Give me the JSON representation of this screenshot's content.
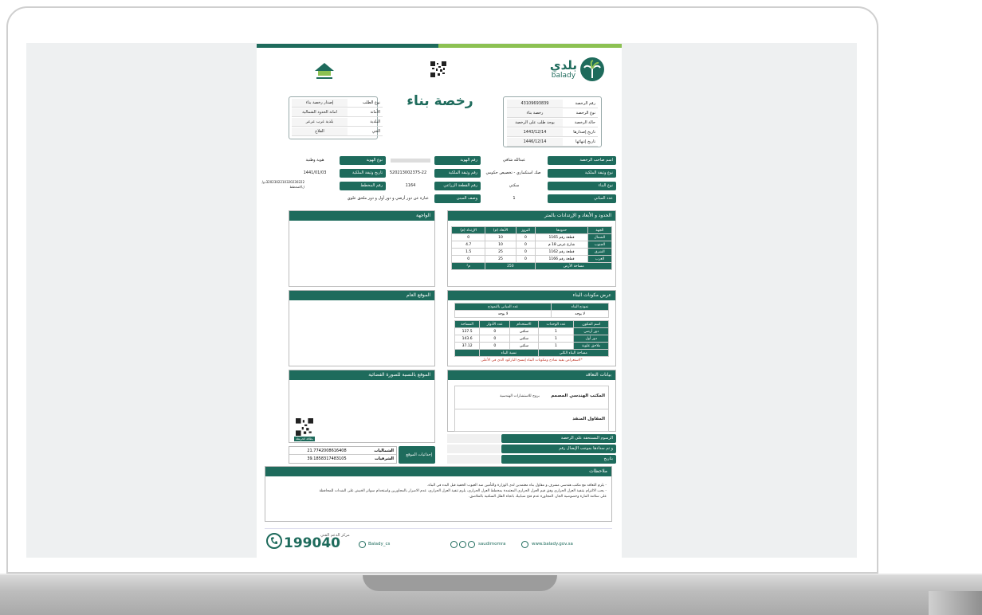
{
  "header": {
    "logo_ar": "بلدي",
    "logo_en": "balady",
    "title": "رخصة بناء"
  },
  "license_info": [
    {
      "label": "رقم الرخصة",
      "value": "43109693839"
    },
    {
      "label": "نوع الرخصة",
      "value": "رخصة بناء"
    },
    {
      "label": "حالة الرخصة",
      "value": "يوجد طلب على الرخصة"
    },
    {
      "label": "تاريخ إصدارها",
      "value": "1443/12/14"
    },
    {
      "label": "تاريخ إنتهائها",
      "value": "1446/12/14"
    }
  ],
  "request_info": [
    {
      "label": "نوع الطلب",
      "value": "إصدار رخصة بناء"
    },
    {
      "label": "الأمانة",
      "value": "امانة الحدود الشمالية"
    },
    {
      "label": "البلدية",
      "value": "بلدية غرب عرعر"
    },
    {
      "label": "الحي",
      "value": "الفلاح"
    }
  ],
  "owner": {
    "owner_label": "اسم صاحب الرخصة",
    "owner_value": "عبدالله شافي",
    "id_label": "رقم الهوية",
    "id_value": "",
    "id_type_label": "نوع الهوية",
    "id_type_value": "هوية وطنية",
    "deed_type_label": "نوع وثيقة الملكية",
    "deed_type_value": "صك استكماري - تخصيص حكومي",
    "deed_no_label": "رقم وثيقة الملكية",
    "deed_no_value": "520213002375-22",
    "deed_date_label": "تاريخ وثيقة الملكية",
    "deed_date_value": "1441/01/03",
    "build_type_label": "نوع البناء",
    "build_type_value": "سكني",
    "plot_label": "رقم القطعة الزراعي",
    "plot_value": "1164",
    "plan_label": "رقم المخطط",
    "plan_value": "3202302210320230222ذو/ل/المخطط",
    "count_label": "عدد المباني",
    "count_value": "1",
    "desc_label": "وصف المبنى",
    "desc_value": "عبارة عن دور أرضي و دور أول و دور ملحق علوي"
  },
  "boundaries": {
    "title": "الحدود و الأبعاد و الإرتدادات بالمتر",
    "headers": [
      "الجهة",
      "حدودها",
      "البروز",
      "الأبعاد (م)",
      "الإرتداد (م)"
    ],
    "rows": [
      [
        "الشمال",
        "قطعة رقم 1165",
        "0",
        "10",
        "0"
      ],
      [
        "الجنوب",
        "شارع عرض 18 م",
        "0",
        "10",
        "4.7"
      ],
      [
        "الشرق",
        "قطعة رقم 1162",
        "0",
        "25",
        "1.5"
      ],
      [
        "الغرب",
        "قطعة رقم 1166",
        "0",
        "25",
        "0"
      ]
    ],
    "area_label": "مساحة الأرض",
    "area_value": "250",
    "area_unit": "م²"
  },
  "facade": {
    "title": "الواجهة"
  },
  "general_site": {
    "title": "الموقع العام"
  },
  "satellite": {
    "title": "الموقع بالنسبة للصورة الفضائية",
    "qr_caption": "بطاقة الخريطة"
  },
  "components": {
    "title": "عرض مكونات البناء",
    "model_label": "نموذج البناء",
    "model_value": "لا يوجد",
    "model_count_label": "عدد المباني بالنموذج",
    "model_count_value": "لا يوجد",
    "headers": [
      "اسم المكون",
      "عدد الوحدات",
      "الاستخدام",
      "عدد الأدوار",
      "المساحة"
    ],
    "rows": [
      [
        "دور أرضي",
        "1",
        "سكني",
        "0",
        "137.5"
      ],
      [
        "دور أول",
        "1",
        "سكني",
        "0",
        "143.6"
      ],
      [
        "ملاحق علوية",
        "1",
        "سكني",
        "0",
        "37.12"
      ]
    ],
    "total_area_label": "مساحة البناء الكلي",
    "ratio_label": "نسبة البناء",
    "warning": "*لاستعراض بقية نماذج ومكونات البناء إمسح الباركود الذي في الأعلى"
  },
  "contract": {
    "title": "بيانات التعاقد",
    "engineer_label": "المكتب الهندسي المصمم",
    "engineer_value": "بروج للاستشارات الهندسية",
    "contractor_label": "المقاول المنفذ",
    "contractor_value": ""
  },
  "fees": [
    {
      "label": "الرسوم المستحقة على الرخصة"
    },
    {
      "label": "و تم سدادها بموجب الإيصال رقم"
    },
    {
      "label": "بتاريخ"
    }
  ],
  "coords": {
    "label": "إحداثيات الموقع",
    "north_label": "الشماليات",
    "north_value": "21.7742008616408",
    "east_label": "الشرقيات",
    "east_value": "39.1858317483105"
  },
  "notes": {
    "title": "ملاحظات",
    "lines": [
      "- يلزم التعاقد مع مكتب هندسي مشرف و مقاول بناء معتمدين لدى الوزارة والتأمين ضد العيوب الخفية قبل البدء في البناء.",
      "- يجب الالتزام بتنفيذ العزل الحراري وفق قيم العزل الحراري المعتمدة بمخطط العزل الحراري، يلزم تنفيذ العزل الحراري، عدم الاضرار بالمجاورين واستخدام سواتر الخيش على الشدات للمحافظة",
      "على سلامة المارة وخصوصية الجار، المجاورة عدم فتح شبابيك باتجاه الفلل السكنية بالملاصق."
    ]
  },
  "footer": {
    "hotline_label": "مركز الدعم الفني",
    "hotline": "199040",
    "twitter": "Balady_cs",
    "social": "saudimomra",
    "website": "www.balady.gov.sa"
  }
}
